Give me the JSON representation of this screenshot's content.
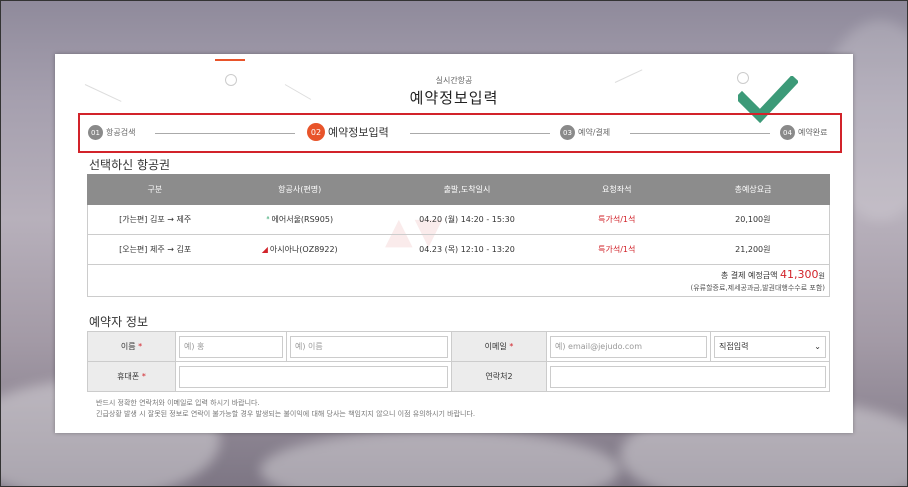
{
  "header": {
    "subtitle": "실시간항공",
    "title": "예약정보입력"
  },
  "steps": [
    {
      "num": "01",
      "label": "항공검색"
    },
    {
      "num": "02",
      "label": "예약정보입력"
    },
    {
      "num": "03",
      "label": "예약/결제"
    },
    {
      "num": "04",
      "label": "예약완료"
    }
  ],
  "flight_section": {
    "title": "선택하신 항공권",
    "columns": [
      "구분",
      "항공사(편명)",
      "출발,도착일시",
      "요청좌석",
      "총예상요금"
    ],
    "rows": [
      {
        "type": "[가는편] 김포 → 제주",
        "airline": "에어서울(RS905)",
        "datetime": "04.20 (월) 14:20 - 15:30",
        "seat": "특가석/1석",
        "fare": "20,100원"
      },
      {
        "type": "[오는편] 제주 → 김포",
        "airline": "아시아나(OZ8922)",
        "datetime": "04.23 (목) 12:10 - 13:20",
        "seat": "특가석/1석",
        "fare": "21,200원"
      }
    ],
    "total_label": "총 결제 예정금액",
    "total_amount": "41,300",
    "total_unit": "원",
    "total_note": "(유류할증료,제세공과금,발권대행수수료 포함)"
  },
  "booker_section": {
    "title": "예약자 정보",
    "name_label": "이름",
    "name_last_placeholder": "예) 홍",
    "name_first_placeholder": "예) 이름",
    "email_label": "이메일",
    "email_placeholder": "예) email@jejudo.com",
    "email_domain_select": "직접입력",
    "phone_label": "휴대폰",
    "contact2_label": "연락처2",
    "required_mark": "*"
  },
  "notes": [
    "반드시 정확한 연락처와 이메일로 입력 하시기 바랍니다.",
    "긴급상황 발생 시 잘못된 정보로 연락이 불가능할 경우 발생되는 불이익에 대해 당사는 책임지지 않으니 이점 유의하시기 바랍니다."
  ],
  "icons": {
    "checkmark": "checkmark-icon",
    "airseoul": "airseoul-logo-icon",
    "asiana": "asiana-logo-icon",
    "dropdown": "chevron-down-icon"
  },
  "colors": {
    "accent": "#e8542a",
    "highlight_border": "#d2232a",
    "check": "#3c9a78",
    "table_header": "#8c8c8c"
  }
}
